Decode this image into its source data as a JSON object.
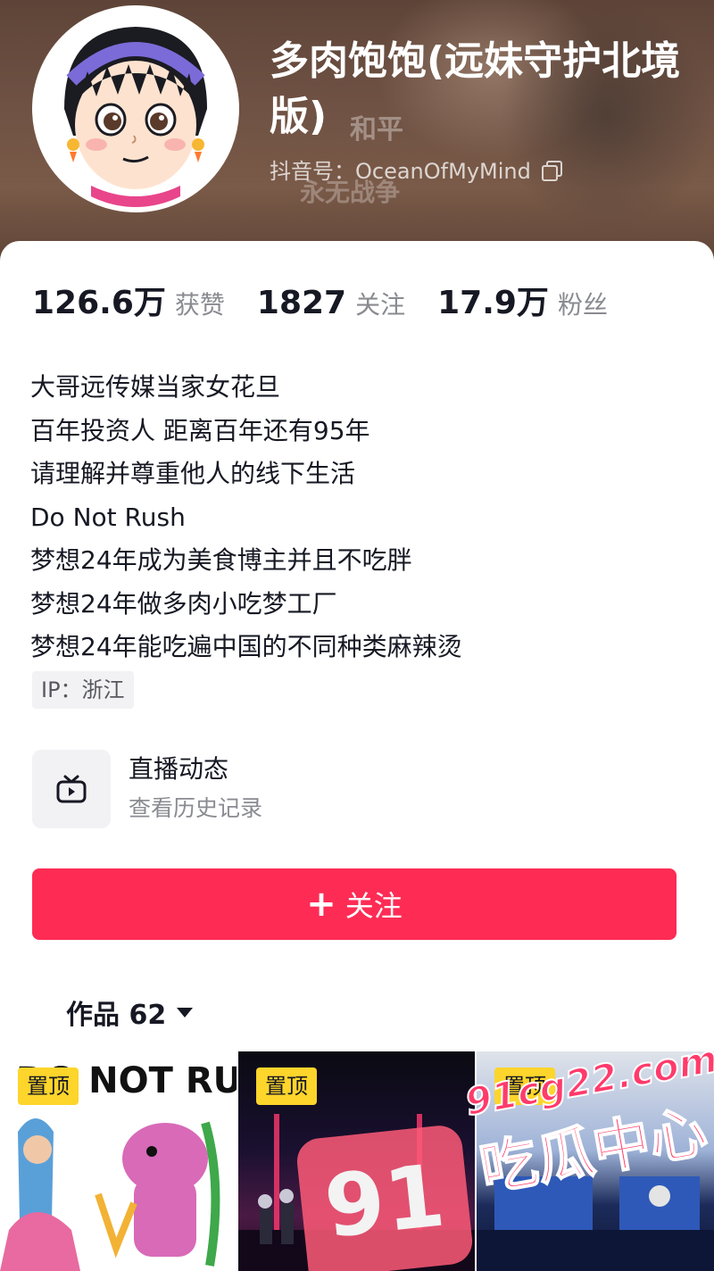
{
  "header": {
    "nickname": "多肉饱饱(远妹守护北境版)",
    "douyin_id": "抖音号：OceanOfMyMind",
    "background_text_1": "和平",
    "background_text_2": "永无战争"
  },
  "stats": {
    "likes_value": "126.6万",
    "likes_label": "获赞",
    "following_value": "1827",
    "following_label": "关注",
    "followers_value": "17.9万",
    "followers_label": "粉丝"
  },
  "bio": {
    "lines": [
      "大哥远传媒当家女花旦",
      "百年投资人 距离百年还有95年",
      "请理解并尊重他人的线下生活",
      "Do Not Rush",
      "梦想24年成为美食博主并且不吃胖",
      "梦想24年做多肉小吃梦工厂",
      "梦想24年能吃遍中国的不同种类麻辣烫"
    ],
    "ip": "IP：浙江"
  },
  "live": {
    "title": "直播动态",
    "subtitle": "查看历史记录",
    "icon": "tv-icon"
  },
  "follow_button": {
    "plus": "+",
    "label": "关注",
    "color": "#fe2c55"
  },
  "works": {
    "tab_label": "作品 62",
    "items": [
      {
        "badge": "置顶",
        "art_text": "DO NOT RUSH"
      },
      {
        "badge": "置顶"
      },
      {
        "badge": "置顶"
      }
    ]
  },
  "watermark": {
    "url": "91cg22.com",
    "site": "吃瓜中心",
    "badge": "91"
  },
  "colors": {
    "accent": "#fe2c55",
    "pin_badge": "#fdd52b",
    "secondary_text": "#8a8b91"
  }
}
